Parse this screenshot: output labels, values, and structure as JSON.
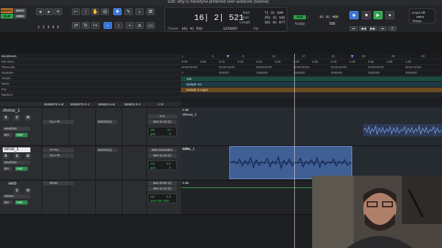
{
  "window": {
    "title": "Edit: why is melodyne preferred over autotune (tutorial)"
  },
  "toolbar": {
    "modes": [
      "SHUFFLE",
      "SPOT",
      "SLIP",
      "GRID"
    ],
    "zoom_presets": [
      "1",
      "2",
      "3",
      "4",
      "5"
    ],
    "counter": {
      "main": "16| 2| 521",
      "cursor_label": "Cursor",
      "cursor_value": "16| 4| 532",
      "samples": "1378297",
      "dly": "Dly",
      "start_label": "Start",
      "end_label": "End",
      "length_label": "Length",
      "start_value": "7| 3| 184",
      "end_value": "25| 3| 101",
      "length_value": "18| 0| 877"
    },
    "grid_label": "Grid",
    "grid_value": "0| 0| 480",
    "nudge_label": "Nudge",
    "nudge_value": "500",
    "countoff": "Count Off",
    "meter": "Meter",
    "tempo": "Tempo"
  },
  "rulers": [
    "Bars|Beats",
    "Min:Secs",
    "Timecode",
    "Samples",
    "Tempo",
    "Meter",
    "Key",
    "Markers"
  ],
  "ruler_bars": [
    "1",
    "5",
    "9",
    "13",
    "17",
    "21",
    "25",
    "29",
    "33"
  ],
  "ruler_mins": [
    "0:00",
    "0:05",
    "0:10",
    "0:15",
    "0:20",
    "0:25",
    "0:30",
    "0:35",
    "0:40",
    "0:45",
    "0:50",
    "0:55",
    "1:00"
  ],
  "ruler_tc": [
    "00:00:00:00",
    "00:00:10:00",
    "00:00:20:00",
    "00:00:30:00",
    "00:00:40:00",
    "00:00:50:00",
    "00:01:00:00"
  ],
  "ruler_samples": [
    "0",
    "500000",
    "1000000",
    "1500000",
    "2000000",
    "2500000",
    "3000000"
  ],
  "tempo_value": "120",
  "meter_value": "Default: 4/4",
  "key_value": "Default: C major",
  "mix_header": [
    "INSERTS A-E",
    "INSERTS F-J",
    "SENDS A-E",
    "SENDS F-J",
    "I / O"
  ],
  "tracks": [
    {
      "name": "chorus_1",
      "view": "waveform",
      "dyn": "dyn",
      "read": "read",
      "inserts": [
        "CLA-76"
      ],
      "send": "Bs2224(1)",
      "input": "In 2",
      "output": "Bus 11-12 (1)",
      "vol_label": "vol",
      "vol": "-3.7",
      "pan_label": "pan",
      "pan": "0"
    },
    {
      "name": "verse_1",
      "view": "waveform",
      "dyn": "dyn",
      "read": "read",
      "inserts": [
        "AT Pro",
        "CLA-76"
      ],
      "send": "Bs2224(1)",
      "input": "Mult.channel(AL",
      "output": "Bus 11-12 (1)",
      "vol_label": "vol",
      "vol": "0.0",
      "pan_label": "pan",
      "pan": "0"
    },
    {
      "name": "verb",
      "view": "volume",
      "dyn": "dyn",
      "read": "read",
      "inserts": [
        "Reom"
      ],
      "send": "",
      "input": "Bus 23-24 (1)",
      "output": "Bus 11-12 (1)",
      "vol_label": "vol",
      "vol": "0.0",
      "pan_label": "pan",
      "pan": "<100  100>"
    }
  ],
  "lanes": [
    {
      "label": "0 dB",
      "clip": "chorus_1"
    },
    {
      "label": "0 dB",
      "clip": "verse_1"
    },
    {
      "label": "0 dB",
      "clip": ""
    }
  ],
  "rsm": [
    "R",
    "S",
    "M"
  ]
}
